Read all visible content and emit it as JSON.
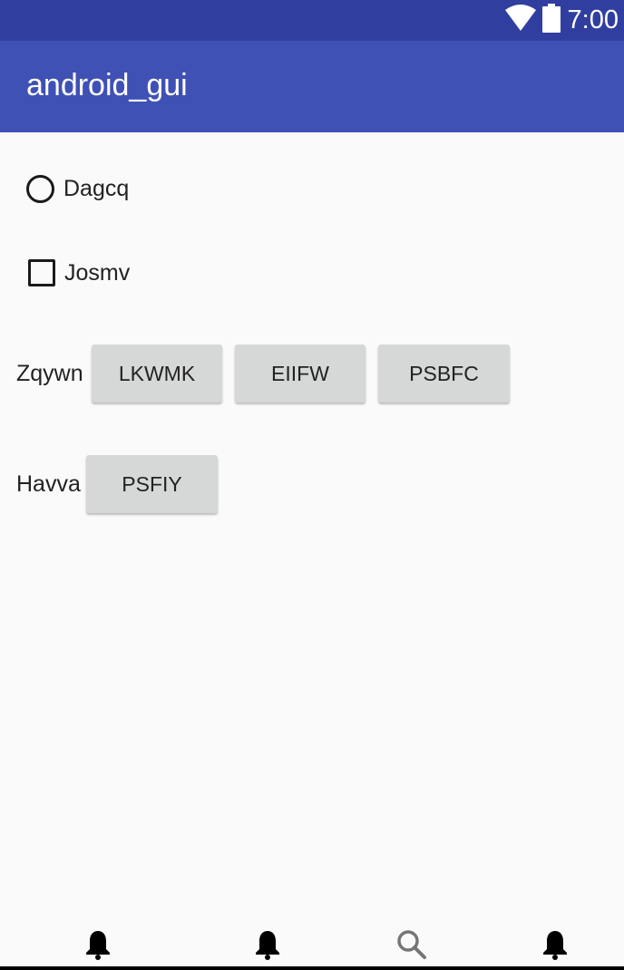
{
  "status_bar": {
    "time": "7:00",
    "icons": [
      "wifi-icon",
      "battery-icon"
    ]
  },
  "app_bar": {
    "title": "android_gui"
  },
  "radio": {
    "label": "Dagcq",
    "checked": false
  },
  "checkbox": {
    "label": "Josmv",
    "checked": false
  },
  "row1": {
    "label": "Zqywn",
    "buttons": [
      "LKWMK",
      "EIIFW",
      "PSBFC"
    ]
  },
  "row2": {
    "label": "Havva",
    "buttons": [
      "PSFIY"
    ]
  },
  "bottom_nav": {
    "icons": [
      "bell-icon",
      "bell-icon",
      "search-icon",
      "bell-icon"
    ]
  },
  "colors": {
    "status_bar": "#303f9f",
    "app_bar": "#3f51b5",
    "background": "#fafafa",
    "button": "#d6d7d7"
  }
}
